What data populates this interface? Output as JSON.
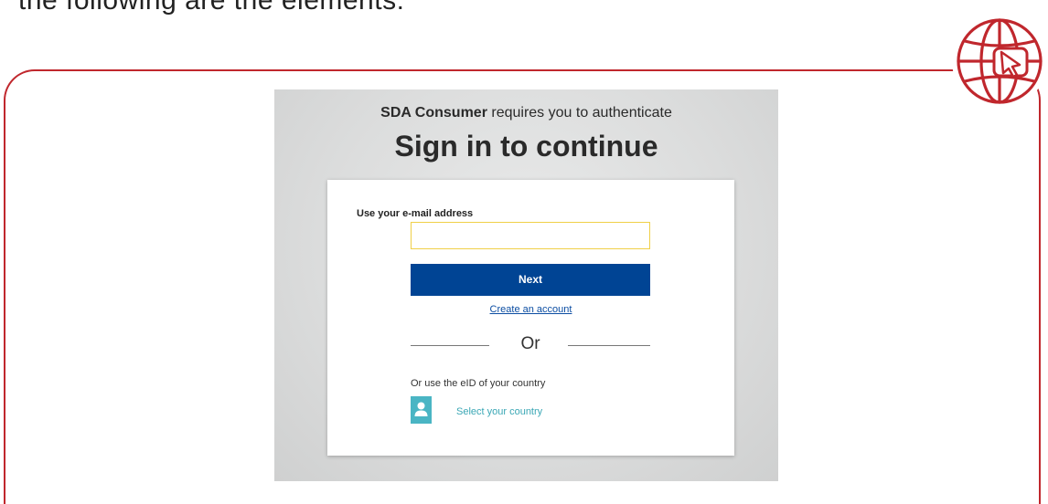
{
  "slide": {
    "top_text_cutoff": "the following are the elements:"
  },
  "header": {
    "app_name": "SDA Consumer",
    "auth_suffix": "requires you to authenticate",
    "title": "Sign in to continue"
  },
  "form": {
    "email_label": "Use your e-mail address",
    "email_value": "",
    "next_label": "Next",
    "create_account_label": "Create an account",
    "or_label": "Or",
    "eid_label": "Or use the eID of your country",
    "country_link_label": "Select your country"
  },
  "colors": {
    "frame": "#c0272d",
    "primary_button": "#004494",
    "input_focus_border": "#f0d048",
    "link": "#0b4da2",
    "country_accent": "#4ab5c4"
  },
  "icons": {
    "badge": "globe-cursor-icon",
    "country": "user-icon"
  }
}
